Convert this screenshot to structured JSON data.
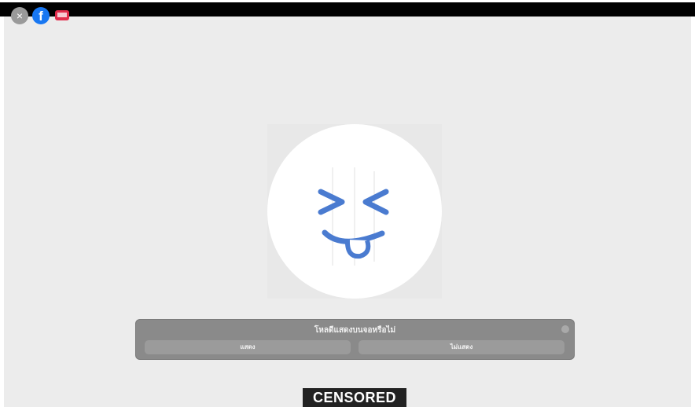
{
  "top_icons": {
    "close_symbol": "×",
    "facebook_letter": "f"
  },
  "dialog": {
    "title": "โหลดีแสดงบนจอหรือไม่",
    "show_button": "แสดง",
    "hide_button": "ไม่แสดง"
  },
  "overlay": {
    "censored_label": "CENSORED"
  },
  "colors": {
    "emoji_blue": "#4a7bd0",
    "panel_gray": "#8a8a8a",
    "censor_bg": "#222222"
  }
}
